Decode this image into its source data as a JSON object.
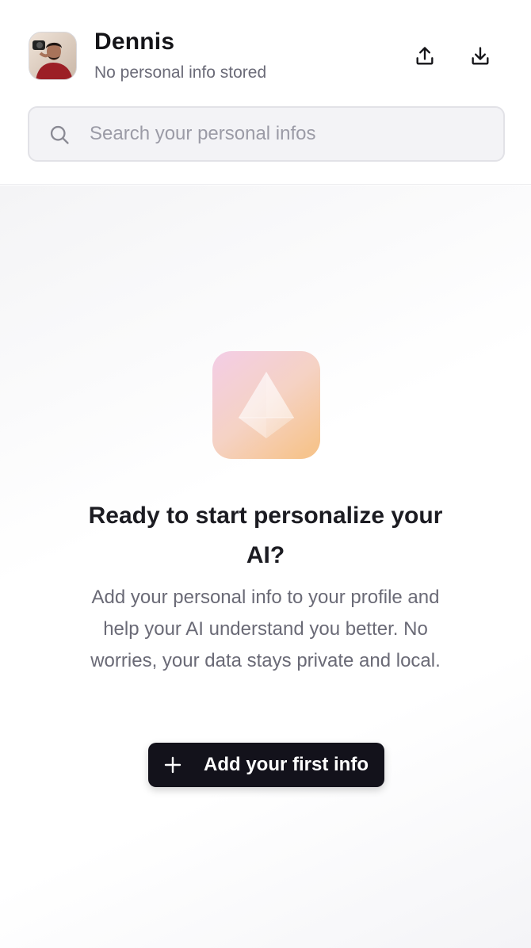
{
  "profile": {
    "name": "Dennis",
    "status": "No personal info stored"
  },
  "toolbar": {
    "upload_icon": "upload-icon",
    "download_icon": "download-icon"
  },
  "search": {
    "placeholder": "Search your personal infos",
    "value": ""
  },
  "empty_state": {
    "title": "Ready to start personalize your AI?",
    "description": "Add your personal info to your profile and help your AI understand you better. No worries, your data stays private and local.",
    "button_label": "Add your first info",
    "button_icon": "plus-icon"
  },
  "colors": {
    "button_bg": "#13121b",
    "hero_gradient": [
      "#f3cde6",
      "#f6c894"
    ]
  }
}
